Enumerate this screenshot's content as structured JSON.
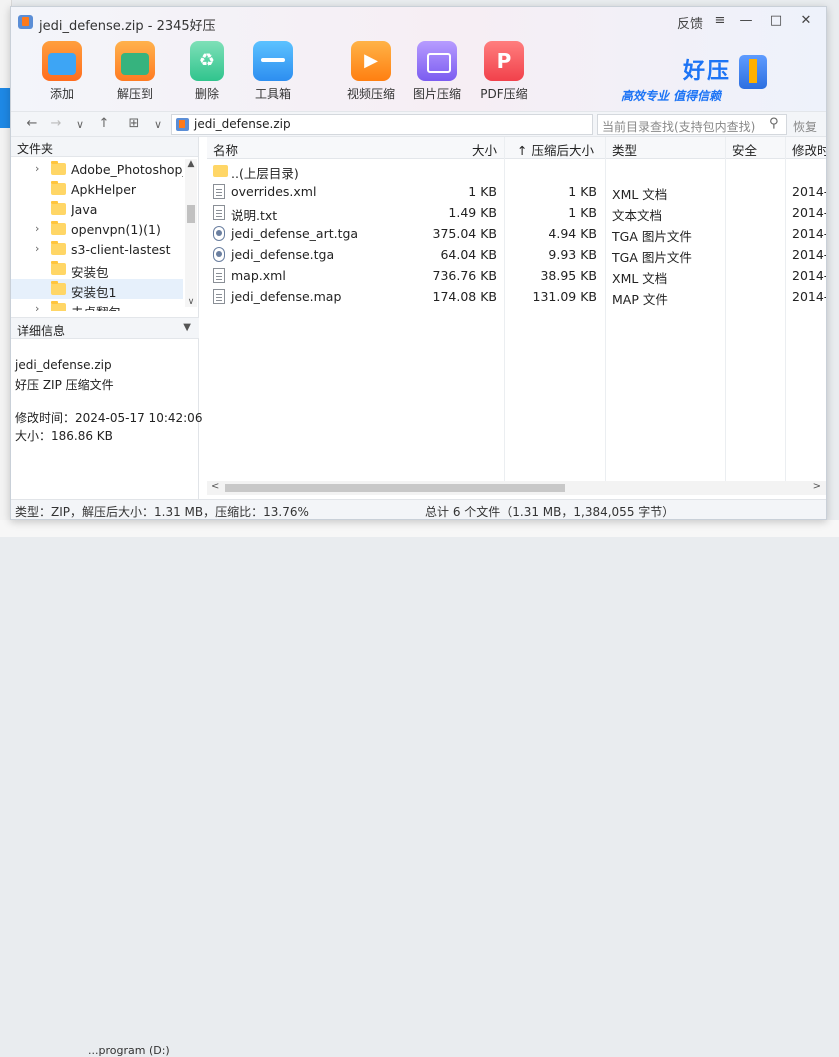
{
  "background": {
    "bottom_text": "...program (D:)"
  },
  "window": {
    "title": "jedi_defense.zip - 2345好压",
    "feedback_label": "反馈",
    "menu_glyph": "≡",
    "minimize_glyph": "—",
    "maximize_glyph": "□",
    "close_glyph": "✕"
  },
  "toolbar": {
    "add": "添加",
    "extract": "解压到",
    "delete": "删除",
    "toolbox": "工具箱",
    "video_compress": "视频压缩",
    "image_compress": "图片压缩",
    "pdf_compress": "PDF压缩"
  },
  "brand": {
    "name": "好压",
    "slogan": "高效专业 值得信赖"
  },
  "navbar": {
    "back_glyph": "←",
    "forward_glyph": "→",
    "history_glyph": "∨",
    "up_glyph": "↑",
    "view_glyph": "⊞",
    "view_dropdown_glyph": "∨",
    "path": "jedi_defense.zip",
    "search_placeholder": "当前目录查找(支持包内查找)",
    "search_glyph": "⚲",
    "reset_label": "恢复"
  },
  "folder_pane": {
    "header": "文件夹",
    "items": [
      {
        "label": "Adobe_Photoshop_",
        "has_children": true
      },
      {
        "label": "ApkHelper",
        "has_children": false
      },
      {
        "label": "Java",
        "has_children": false
      },
      {
        "label": "openvpn(1)(1)",
        "has_children": true
      },
      {
        "label": "s3-client-lastest",
        "has_children": true
      },
      {
        "label": "安装包",
        "has_children": false
      },
      {
        "label": "安装包1",
        "has_children": false
      },
      {
        "label": "去卓翻包",
        "has_children": true
      }
    ],
    "chevron_glyph": "›",
    "scroll_up_glyph": "▲",
    "scroll_down_glyph": "∨"
  },
  "details": {
    "header": "详细信息",
    "dropdown_glyph": "▼",
    "filename": "jedi_defense.zip",
    "filetype": "好压 ZIP 压缩文件",
    "modified": "修改时间：2024-05-17 10:42:06",
    "size": "大小：186.86 KB"
  },
  "file_list": {
    "columns": {
      "name": "名称",
      "size": "大小",
      "compressed": "↑ 压缩后大小",
      "type": "类型",
      "security": "安全",
      "modified": "修改时"
    },
    "rows": [
      {
        "icon": "parent-folder-icon",
        "name": "..(上层目录)",
        "size": "",
        "compressed": "",
        "type": "",
        "modified": ""
      },
      {
        "icon": "document-icon",
        "name": "overrides.xml",
        "size": "1 KB",
        "compressed": "1 KB",
        "type": "XML 文档",
        "modified": "2014-"
      },
      {
        "icon": "document-icon",
        "name": "说明.txt",
        "size": "1.49 KB",
        "compressed": "1 KB",
        "type": "文本文档",
        "modified": "2014-"
      },
      {
        "icon": "image-file-icon",
        "name": "jedi_defense_art.tga",
        "size": "375.04 KB",
        "compressed": "4.94 KB",
        "type": "TGA 图片文件",
        "modified": "2014-"
      },
      {
        "icon": "image-file-icon",
        "name": "jedi_defense.tga",
        "size": "64.04 KB",
        "compressed": "9.93 KB",
        "type": "TGA 图片文件",
        "modified": "2014-"
      },
      {
        "icon": "document-icon",
        "name": "map.xml",
        "size": "736.76 KB",
        "compressed": "38.95 KB",
        "type": "XML 文档",
        "modified": "2014-"
      },
      {
        "icon": "document-icon",
        "name": "jedi_defense.map",
        "size": "174.08 KB",
        "compressed": "131.09 KB",
        "type": "MAP 文件",
        "modified": "2014-"
      }
    ],
    "scroll_left_glyph": "<",
    "scroll_right_glyph": ">"
  },
  "status": {
    "left": "类型：ZIP，解压后大小：1.31 MB，压缩比：13.76%",
    "right": "总计 6 个文件（1.31 MB，1,384,055 字节）"
  },
  "colors": {
    "accent": "#1d74f5",
    "selection": "#e6f0fb",
    "folder": "#ffd666"
  }
}
